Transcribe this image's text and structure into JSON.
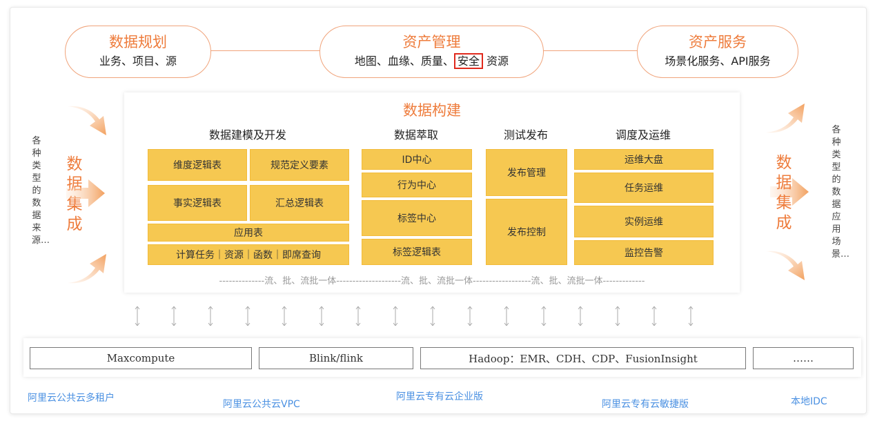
{
  "top": {
    "planning": {
      "title": "数据规划",
      "subtitle": "业务、项目、源"
    },
    "management": {
      "title": "资产管理",
      "subtitle_prefix": "地图、血缘、质量、",
      "highlight": "安全",
      "subtitle_suffix": "资源"
    },
    "service": {
      "title": "资产服务",
      "subtitle": "场景化服务、API服务"
    }
  },
  "build": {
    "title": "数据构建",
    "columns": [
      {
        "title": "数据建模及开发",
        "items": [
          "维度逻辑表",
          "规范定义要素",
          "事实逻辑表",
          "汇总逻辑表",
          "应用表",
          "计算任务｜资源｜函数｜即席查询"
        ]
      },
      {
        "title": "数据萃取",
        "items": [
          "ID中心",
          "行为中心",
          "标签中心",
          "标签逻辑表"
        ]
      },
      {
        "title": "测试发布",
        "items": [
          "发布管理",
          "发布控制"
        ]
      },
      {
        "title": "调度及运维",
        "items": [
          "运维大盘",
          "任务运维",
          "实例运维",
          "监控告警"
        ]
      }
    ],
    "footer": "--------------流、批、流批一体--------------------流、批、流批一体------------------流、批、流批一体-------------"
  },
  "left": {
    "source_text": "各种类型的数据来源…",
    "integration": "数据集成"
  },
  "right": {
    "app_text": "各种类型的数据应用场景…",
    "integration": "数据集成"
  },
  "engines": [
    "Maxcompute",
    "Blink/flink",
    "Hadoop：EMR、CDH、CDP、FusionInsight",
    "……"
  ],
  "deployments": [
    "阿里云公共云多租户",
    "阿里云公共云VPC",
    "阿里云专有云企业版",
    "阿里云专有云敏捷版",
    "本地IDC"
  ],
  "colors": {
    "accent": "#ee7c3c",
    "box": "#f6c851",
    "highlight_border": "#e0281b",
    "deploy_text": "#4a90e2"
  },
  "icons": {
    "integration_arrow": "arrow-icon",
    "vertical_link": "double-arrow-icon"
  }
}
